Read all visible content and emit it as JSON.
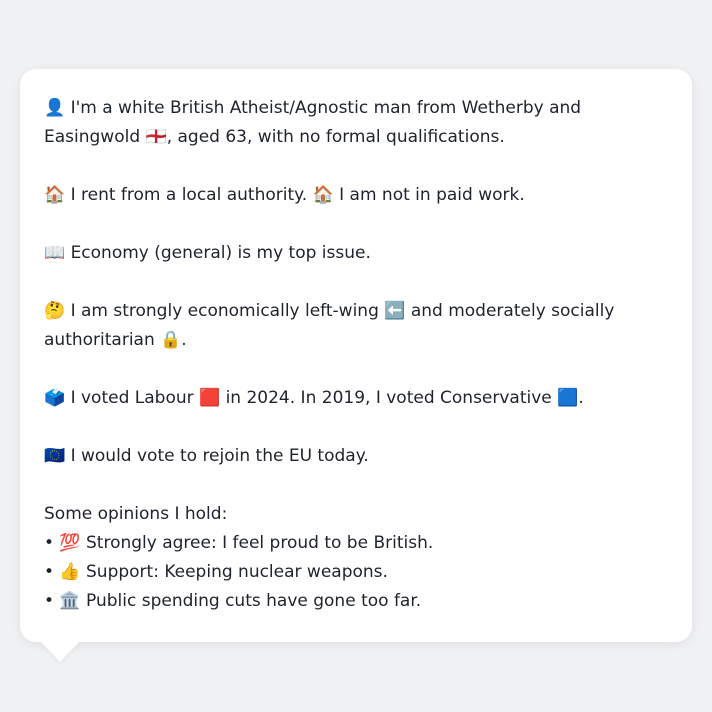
{
  "profile": {
    "line1": "👤 I'm a white British Atheist/Agnostic man from Wetherby and Easingwold 🏴󠁧󠁢󠁥󠁮󠁧󠁿, aged 63, with no formal qualifications.",
    "line2": "🏠 I rent from a local authority. 🏠 I am not in paid work.",
    "line3": "📖 Economy (general) is my top issue.",
    "line4": "🤔 I am strongly economically left-wing ⬅️ and moderately socially authoritarian 🔒.",
    "line5": "🗳️ I voted Labour 🟥 in 2024. In 2019, I voted Conservative 🟦.",
    "line6": "🇪🇺 I would vote to rejoin the EU today."
  },
  "opinions": {
    "heading": "Some opinions I hold:",
    "items": [
      "• 💯 Strongly agree: I feel proud to be British.",
      "• 👍 Support: Keeping nuclear weapons.",
      "• 🏛️ Public spending cuts have gone too far."
    ]
  }
}
